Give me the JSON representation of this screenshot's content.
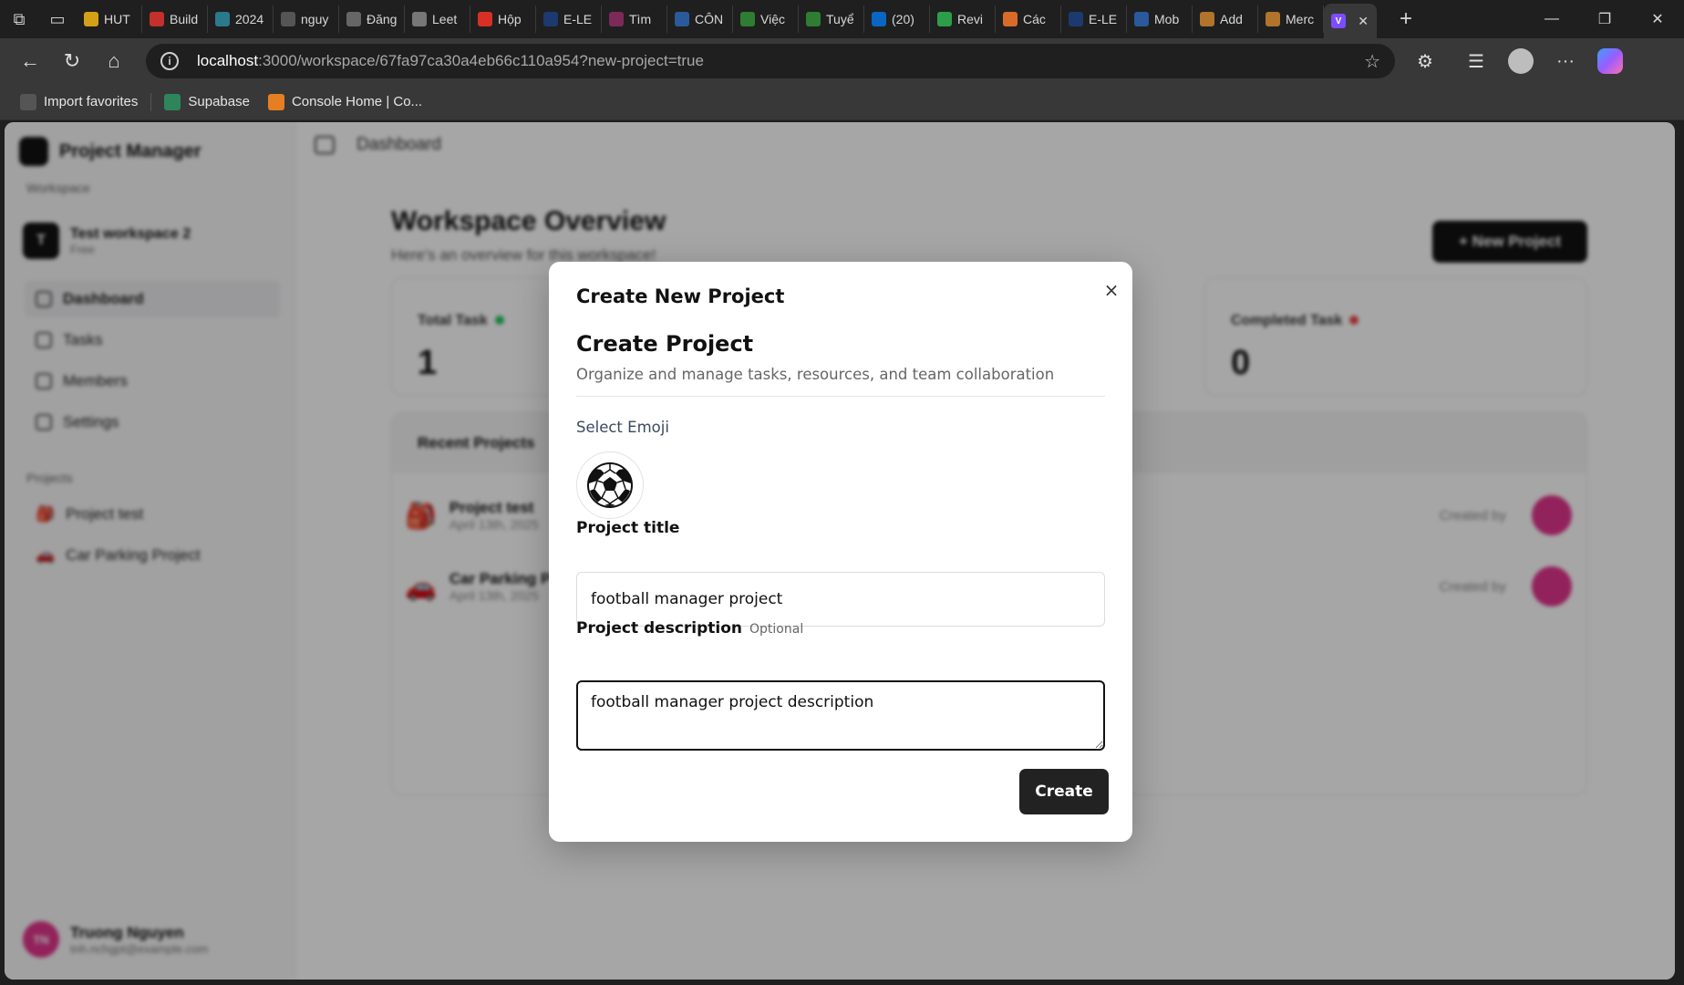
{
  "browser": {
    "tabs": [
      {
        "label": "HUT",
        "color": "#d4a017"
      },
      {
        "label": "Build",
        "color": "#c4302b"
      },
      {
        "label": "2024",
        "color": "#2a7a8c"
      },
      {
        "label": "nguy",
        "color": "#555555"
      },
      {
        "label": "Đăng",
        "color": "#666666"
      },
      {
        "label": "Leet",
        "color": "#777777"
      },
      {
        "label": "Hộp",
        "color": "#d93025"
      },
      {
        "label": "E-LE",
        "color": "#1c3a70"
      },
      {
        "label": "Tìm",
        "color": "#7b2a5a"
      },
      {
        "label": "CÔN",
        "color": "#2a5a9c"
      },
      {
        "label": "Việc",
        "color": "#2e7d32"
      },
      {
        "label": "Tuyể",
        "color": "#2e7d32"
      },
      {
        "label": "(20)",
        "color": "#0a66c2"
      },
      {
        "label": "Revi",
        "color": "#2e9d4a"
      },
      {
        "label": "Các",
        "color": "#d96b2a"
      },
      {
        "label": "E-LE",
        "color": "#1c3a70"
      },
      {
        "label": "Mob",
        "color": "#2a5a9c"
      },
      {
        "label": "Add",
        "color": "#b0742a"
      },
      {
        "label": "Merc",
        "color": "#b0742a"
      }
    ],
    "url_host": "localhost",
    "url_path": ":3000/workspace/67fa97ca30a4eb66c110a954?new-project=true",
    "bookmarks": [
      {
        "label": "Import favorites",
        "color": "#555555"
      },
      {
        "label": "Supabase",
        "color": "#2f855a"
      },
      {
        "label": "Console Home | Co...",
        "color": "#e67e22"
      }
    ]
  },
  "sidebar": {
    "brand": "Project Manager",
    "workspace_section": "Workspace",
    "workspace_initial": "T",
    "workspace_name": "Test workspace 2",
    "workspace_role": "Free",
    "nav": [
      "Dashboard",
      "Tasks",
      "Members",
      "Settings"
    ],
    "projects_section": "Projects",
    "projects": [
      {
        "emoji": "🎒",
        "name": "Project test"
      },
      {
        "emoji": "🚗",
        "name": "Car Parking Project"
      }
    ],
    "user_initials": "TN",
    "user_name": "Truong Nguyen",
    "user_email": "tnh.nchgpt@example.com"
  },
  "main": {
    "breadcrumb": "Dashboard",
    "title": "Workspace Overview",
    "subtitle": "Here's an overview for this workspace!",
    "new_project_label": "+ New Project",
    "cards": [
      {
        "label": "Total Task",
        "value": "1",
        "dot": "#22c55e"
      },
      {
        "label": "Completed Task",
        "value": "0",
        "dot": "#ef4444"
      }
    ],
    "recent_title": "Recent Projects",
    "recent": [
      {
        "emoji": "🎒",
        "name": "Project test",
        "date": "April 13th, 2025",
        "created": "Created by"
      },
      {
        "emoji": "🚗",
        "name": "Car Parking Pr...",
        "date": "April 13th, 2025",
        "created": "Created by"
      }
    ]
  },
  "modal": {
    "title": "Create New Project",
    "close_label": "×",
    "section_title": "Create Project",
    "section_subtitle": "Organize and manage tasks, resources, and team collaboration",
    "emoji_label": "Select Emoji",
    "selected_emoji": "soccer-ball-icon",
    "title_label": "Project title",
    "title_value": "football manager project",
    "description_label": "Project description",
    "optional_label": "Optional",
    "description_value": "football manager project description",
    "create_label": "Create"
  }
}
